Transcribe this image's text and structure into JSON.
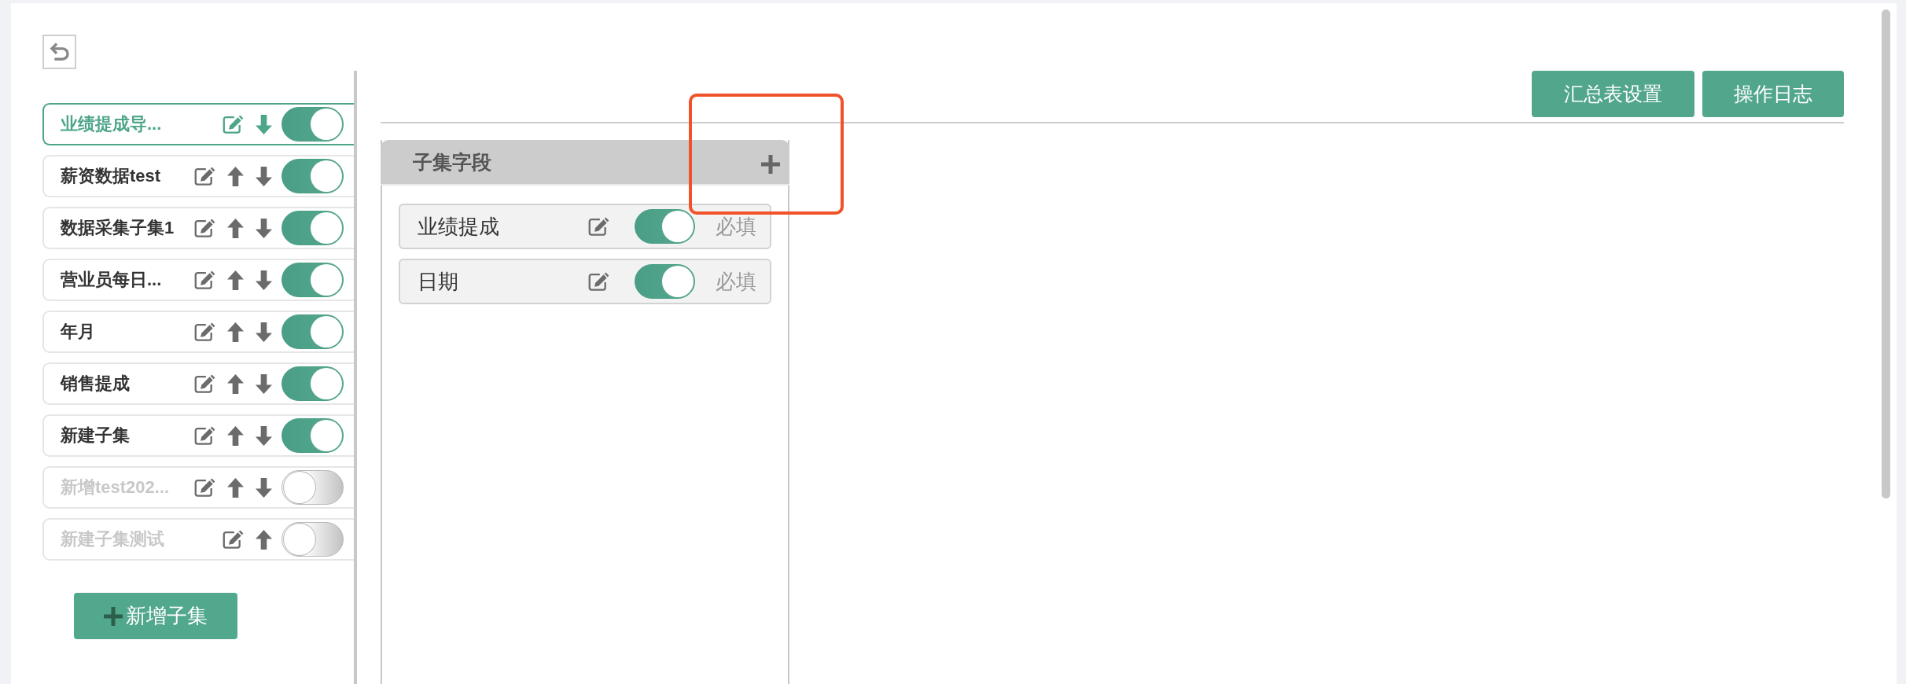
{
  "top_actions": [
    {
      "label": "汇总表设置"
    },
    {
      "label": "操作日志"
    }
  ],
  "subsets": {
    "items": [
      {
        "label": "业绩提成导...",
        "selected": true,
        "on": true,
        "move_up": false,
        "move_down": true
      },
      {
        "label": "薪资数据test",
        "selected": false,
        "on": true,
        "move_up": true,
        "move_down": true
      },
      {
        "label": "数据采集子集1",
        "selected": false,
        "on": true,
        "move_up": true,
        "move_down": true
      },
      {
        "label": "营业员每日...",
        "selected": false,
        "on": true,
        "move_up": true,
        "move_down": true
      },
      {
        "label": "年月",
        "selected": false,
        "on": true,
        "move_up": true,
        "move_down": true
      },
      {
        "label": "销售提成",
        "selected": false,
        "on": true,
        "move_up": true,
        "move_down": true
      },
      {
        "label": "新建子集",
        "selected": false,
        "on": true,
        "move_up": true,
        "move_down": true
      },
      {
        "label": "新增test202...",
        "selected": false,
        "on": false,
        "move_up": true,
        "move_down": true
      },
      {
        "label": "新建子集测试",
        "selected": false,
        "on": false,
        "move_up": true,
        "move_down": false
      }
    ],
    "add_button": {
      "label": "新增子集"
    }
  },
  "fields_panel": {
    "title": "子集字段",
    "fields": [
      {
        "label": "业绩提成",
        "required": true,
        "required_label": "必填"
      },
      {
        "label": "日期",
        "required": true,
        "required_label": "必填"
      }
    ]
  }
}
